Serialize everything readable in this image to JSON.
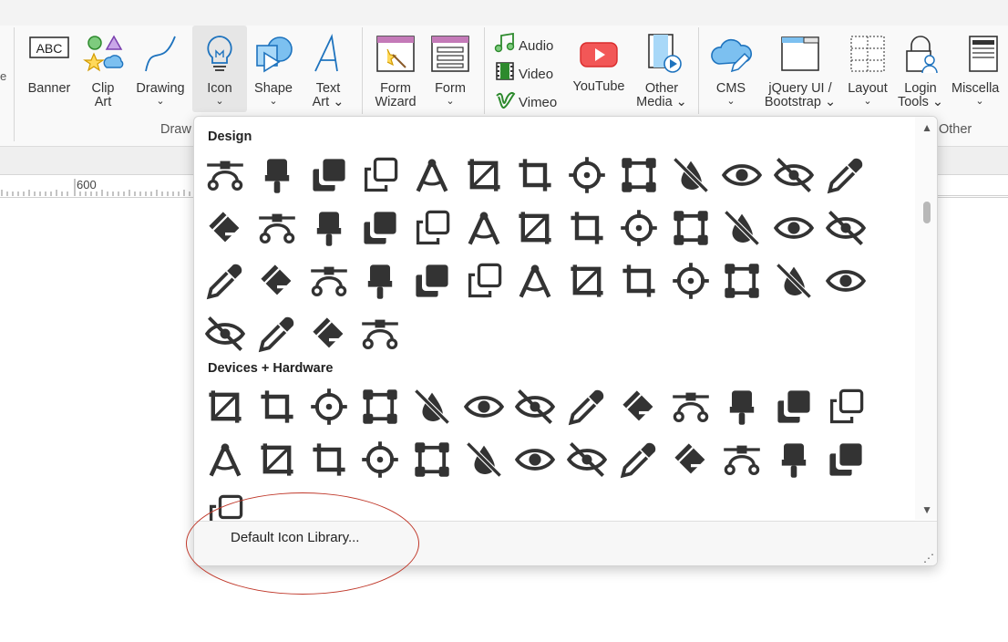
{
  "ribbon": {
    "buttons": [
      {
        "name": "banner",
        "label": "Banner",
        "chevron": "",
        "icon": "abc-banner-icon"
      },
      {
        "name": "clip-art",
        "label": "Clip\nArt",
        "chevron": "",
        "icon": "shapes-icon"
      },
      {
        "name": "drawing",
        "label": "Drawing",
        "chevron": "⌄",
        "icon": "curve-icon"
      },
      {
        "name": "icon",
        "label": "Icon",
        "chevron": "⌄",
        "icon": "lightbulb-icon"
      },
      {
        "name": "shape",
        "label": "Shape",
        "chevron": "⌄",
        "icon": "shape-icon"
      },
      {
        "name": "text-art",
        "label": "Text\nArt ⌄",
        "chevron": "",
        "icon": "text-a-icon"
      },
      {
        "name": "form-wizard",
        "label": "Form\nWizard",
        "chevron": "",
        "icon": "form-wizard-icon"
      },
      {
        "name": "form",
        "label": "Form",
        "chevron": "⌄",
        "icon": "form-icon"
      },
      {
        "name": "youtube",
        "label": "YouTube",
        "chevron": "",
        "icon": "youtube-icon"
      },
      {
        "name": "other-media",
        "label": "Other\nMedia ⌄",
        "chevron": "",
        "icon": "film-icon"
      },
      {
        "name": "cms",
        "label": "CMS",
        "chevron": "⌄",
        "icon": "cloud-pencil-icon"
      },
      {
        "name": "jquery-ui",
        "label": "jQuery UI /\nBootstrap ⌄",
        "chevron": "",
        "icon": "window-icon"
      },
      {
        "name": "layout",
        "label": "Layout",
        "chevron": "⌄",
        "icon": "layout-grid-icon"
      },
      {
        "name": "login-tools",
        "label": "Login\nTools ⌄",
        "chevron": "",
        "icon": "lock-user-icon"
      },
      {
        "name": "miscellaneous",
        "label": "Miscella",
        "chevron": "⌄",
        "icon": "news-icon"
      }
    ],
    "media_small": [
      {
        "name": "audio",
        "label": "Audio",
        "icon": "music-note-icon"
      },
      {
        "name": "video",
        "label": "Video",
        "icon": "film-strip-icon"
      },
      {
        "name": "vimeo",
        "label": "Vimeo",
        "icon": "vimeo-icon"
      }
    ],
    "group_labels": {
      "draw": "Draw",
      "other": "Other"
    },
    "left_edge_glyph": "e"
  },
  "ruler": {
    "number": "600"
  },
  "popup": {
    "sections": [
      {
        "title": "Design",
        "icons": [
          "bezier-curve-icon",
          "brush-icon",
          "clone-solid-icon",
          "clone-outline-icon",
          "compass-drafting-icon",
          "crop-alt-icon",
          "crop-icon",
          "crosshairs-icon",
          "vector-square-icon",
          "eye-dropper-slash-icon",
          "eye-icon",
          "eye-slash-icon",
          "eye-dropper-icon",
          "fill-icon",
          "fill-drip-icon",
          "icons-icon",
          "layer-group-icon",
          "lines-leaning-icon",
          "marker-icon",
          "pen-icon",
          "object-group-icon",
          "object-ungroup-icon",
          "paint-brush-icon",
          "palette-icon",
          "pencil-icon",
          "pen-alt-icon",
          "pen-fancy-icon",
          "pen-nib-icon",
          "pen-ruler-icon",
          "pencil-outline-icon",
          "pen-square-icon",
          "ruler-combined-icon",
          "ruler-horizontal-icon",
          "ruler-vertical-icon",
          "shapes-icon",
          "splotch-icon",
          "spray-can-icon",
          "stamp-icon",
          "stapler-icon",
          "swatchbook-icon",
          "droplet-icon",
          "square-corners-icon",
          "wand-magic-sparkles-icon"
        ]
      },
      {
        "title": "Devices + Hardware",
        "icons": [
          "computer-icon",
          "mouse-icon",
          "database-icon",
          "desktop-icon",
          "display-icon",
          "download-icon",
          "floppy-disk-icon",
          "hard-drive-icon",
          "house-laptop-icon",
          "keyboard-icon",
          "laptop-icon",
          "memory-icon",
          "microchip-icon",
          "mobile-icon",
          "mobile-button-icon",
          "mobile-screen-icon",
          "mobile-screen-button-icon",
          "power-off-icon",
          "print-icon",
          "sd-card-icon",
          "server-icon",
          "sim-card-icon",
          "tablet-icon",
          "tablet-button-icon",
          "tablet-screen-icon",
          "hdd-icon",
          "upload-icon"
        ]
      }
    ],
    "footer_item": "Default Icon Library..."
  },
  "colors": {
    "accent_blue": "#1e73be",
    "annotation_red": "#c0392b",
    "icon_dark": "#333333"
  }
}
